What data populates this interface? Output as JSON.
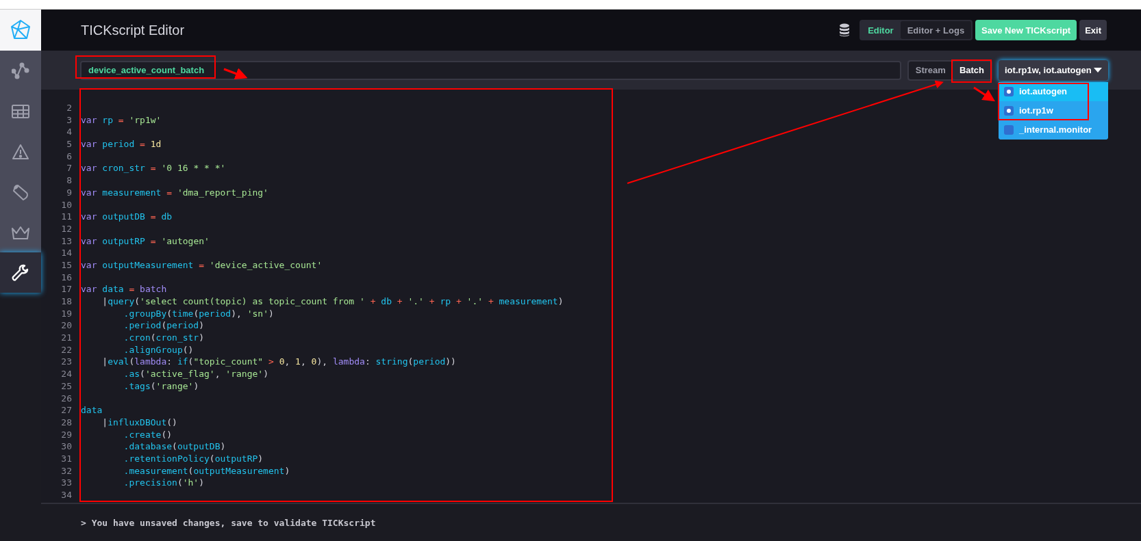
{
  "sidebar": {
    "items": [
      {
        "selected": false
      },
      {
        "selected": false
      },
      {
        "selected": false
      },
      {
        "selected": false
      },
      {
        "selected": false
      },
      {
        "selected": true
      }
    ]
  },
  "header": {
    "title": "TICKscript Editor",
    "view_tabs": [
      {
        "label": "Editor",
        "selected": true
      },
      {
        "label": "Editor + Logs",
        "selected": false
      }
    ],
    "save_button": "Save New TICKscript",
    "exit_button": "Exit"
  },
  "toolbar": {
    "script_name": "device_active_count_batch",
    "type_tabs": [
      {
        "label": "Stream",
        "selected": false
      },
      {
        "label": "Batch",
        "selected": true
      }
    ],
    "db_dropdown": {
      "value": "iot.rp1w, iot.autogen",
      "expanded": true,
      "options": [
        {
          "label": "iot.autogen",
          "selected": true,
          "hovered": true
        },
        {
          "label": "iot.rp1w",
          "selected": true,
          "hovered": false
        },
        {
          "label": "_internal.monitor",
          "selected": false,
          "hovered": false
        }
      ]
    }
  },
  "code": {
    "lines": [
      {
        "number": "2"
      },
      {
        "number": "3",
        "tokens": [
          {
            "kind": "keyword",
            "text": "var"
          },
          {
            "kind": "ident",
            "text": " rp"
          },
          {
            "kind": "operator",
            "text": " = "
          },
          {
            "kind": "string",
            "text": "'rp1w'"
          }
        ]
      },
      {
        "number": "4"
      },
      {
        "number": "5",
        "tokens": [
          {
            "kind": "keyword",
            "text": "var"
          },
          {
            "kind": "ident",
            "text": " period"
          },
          {
            "kind": "operator",
            "text": " = "
          },
          {
            "kind": "number",
            "text": "1d"
          }
        ]
      },
      {
        "number": "6"
      },
      {
        "number": "7",
        "tokens": [
          {
            "kind": "keyword",
            "text": "var"
          },
          {
            "kind": "ident",
            "text": " cron_str"
          },
          {
            "kind": "operator",
            "text": " = "
          },
          {
            "kind": "string",
            "text": "'0 16 * * *'"
          }
        ]
      },
      {
        "number": "8"
      },
      {
        "number": "9",
        "tokens": [
          {
            "kind": "keyword",
            "text": "var"
          },
          {
            "kind": "ident",
            "text": " measurement"
          },
          {
            "kind": "operator",
            "text": " = "
          },
          {
            "kind": "string",
            "text": "'dma_report_ping'"
          }
        ]
      },
      {
        "number": "10"
      },
      {
        "number": "11",
        "tokens": [
          {
            "kind": "keyword",
            "text": "var"
          },
          {
            "kind": "ident",
            "text": " outputDB"
          },
          {
            "kind": "operator",
            "text": " = "
          },
          {
            "kind": "ident",
            "text": "db"
          }
        ]
      },
      {
        "number": "12"
      },
      {
        "number": "13",
        "tokens": [
          {
            "kind": "keyword",
            "text": "var"
          },
          {
            "kind": "ident",
            "text": " outputRP"
          },
          {
            "kind": "operator",
            "text": " = "
          },
          {
            "kind": "string",
            "text": "'autogen'"
          }
        ]
      },
      {
        "number": "14"
      },
      {
        "number": "15",
        "tokens": [
          {
            "kind": "keyword",
            "text": "var"
          },
          {
            "kind": "ident",
            "text": " outputMeasurement"
          },
          {
            "kind": "operator",
            "text": " = "
          },
          {
            "kind": "string",
            "text": "'device_active_count'"
          }
        ]
      },
      {
        "number": "16"
      },
      {
        "number": "17",
        "tokens": [
          {
            "kind": "keyword",
            "text": "var"
          },
          {
            "kind": "ident",
            "text": " data"
          },
          {
            "kind": "operator",
            "text": " = "
          },
          {
            "kind": "keyword",
            "text": "batch"
          }
        ]
      },
      {
        "number": "18",
        "tokens": [
          {
            "kind": "plain",
            "text": "    |"
          },
          {
            "kind": "ident",
            "text": "query"
          },
          {
            "kind": "plain",
            "text": "("
          },
          {
            "kind": "string",
            "text": "'select count(topic) as topic_count from '"
          },
          {
            "kind": "operator",
            "text": " + "
          },
          {
            "kind": "ident",
            "text": "db"
          },
          {
            "kind": "operator",
            "text": " + "
          },
          {
            "kind": "string",
            "text": "'.'"
          },
          {
            "kind": "operator",
            "text": " + "
          },
          {
            "kind": "ident",
            "text": "rp"
          },
          {
            "kind": "operator",
            "text": " + "
          },
          {
            "kind": "string",
            "text": "'.'"
          },
          {
            "kind": "operator",
            "text": " + "
          },
          {
            "kind": "ident",
            "text": "measurement"
          },
          {
            "kind": "plain",
            "text": ")"
          }
        ]
      },
      {
        "number": "19",
        "tokens": [
          {
            "kind": "ident",
            "text": "        .groupBy"
          },
          {
            "kind": "plain",
            "text": "("
          },
          {
            "kind": "ident",
            "text": "time"
          },
          {
            "kind": "plain",
            "text": "("
          },
          {
            "kind": "ident",
            "text": "period"
          },
          {
            "kind": "plain",
            "text": "), "
          },
          {
            "kind": "string",
            "text": "'sn'"
          },
          {
            "kind": "plain",
            "text": ")"
          }
        ]
      },
      {
        "number": "20",
        "tokens": [
          {
            "kind": "ident",
            "text": "        .period"
          },
          {
            "kind": "plain",
            "text": "("
          },
          {
            "kind": "ident",
            "text": "period"
          },
          {
            "kind": "plain",
            "text": ")"
          }
        ]
      },
      {
        "number": "21",
        "tokens": [
          {
            "kind": "ident",
            "text": "        .cron"
          },
          {
            "kind": "plain",
            "text": "("
          },
          {
            "kind": "ident",
            "text": "cron_str"
          },
          {
            "kind": "plain",
            "text": ")"
          }
        ]
      },
      {
        "number": "22",
        "tokens": [
          {
            "kind": "ident",
            "text": "        .alignGroup"
          },
          {
            "kind": "plain",
            "text": "()"
          }
        ]
      },
      {
        "number": "23",
        "tokens": [
          {
            "kind": "plain",
            "text": "    |"
          },
          {
            "kind": "ident",
            "text": "eval"
          },
          {
            "kind": "plain",
            "text": "("
          },
          {
            "kind": "keyword",
            "text": "lambda"
          },
          {
            "kind": "plain",
            "text": ": "
          },
          {
            "kind": "ident",
            "text": "if"
          },
          {
            "kind": "plain",
            "text": "("
          },
          {
            "kind": "string",
            "text": "\"topic_count\""
          },
          {
            "kind": "operator",
            "text": " > "
          },
          {
            "kind": "number",
            "text": "0"
          },
          {
            "kind": "plain",
            "text": ", "
          },
          {
            "kind": "number",
            "text": "1"
          },
          {
            "kind": "plain",
            "text": ", "
          },
          {
            "kind": "number",
            "text": "0"
          },
          {
            "kind": "plain",
            "text": "), "
          },
          {
            "kind": "keyword",
            "text": "lambda"
          },
          {
            "kind": "plain",
            "text": ": "
          },
          {
            "kind": "ident",
            "text": "string"
          },
          {
            "kind": "plain",
            "text": "("
          },
          {
            "kind": "ident",
            "text": "period"
          },
          {
            "kind": "plain",
            "text": "))"
          }
        ]
      },
      {
        "number": "24",
        "tokens": [
          {
            "kind": "ident",
            "text": "        .as"
          },
          {
            "kind": "plain",
            "text": "("
          },
          {
            "kind": "string",
            "text": "'active_flag'"
          },
          {
            "kind": "plain",
            "text": ", "
          },
          {
            "kind": "string",
            "text": "'range'"
          },
          {
            "kind": "plain",
            "text": ")"
          }
        ]
      },
      {
        "number": "25",
        "tokens": [
          {
            "kind": "ident",
            "text": "        .tags"
          },
          {
            "kind": "plain",
            "text": "("
          },
          {
            "kind": "string",
            "text": "'range'"
          },
          {
            "kind": "plain",
            "text": ")"
          }
        ]
      },
      {
        "number": "26"
      },
      {
        "number": "27",
        "tokens": [
          {
            "kind": "ident",
            "text": "data"
          }
        ]
      },
      {
        "number": "28",
        "tokens": [
          {
            "kind": "plain",
            "text": "    |"
          },
          {
            "kind": "ident",
            "text": "influxDBOut"
          },
          {
            "kind": "plain",
            "text": "()"
          }
        ]
      },
      {
        "number": "29",
        "tokens": [
          {
            "kind": "ident",
            "text": "        .create"
          },
          {
            "kind": "plain",
            "text": "()"
          }
        ]
      },
      {
        "number": "30",
        "tokens": [
          {
            "kind": "ident",
            "text": "        .database"
          },
          {
            "kind": "plain",
            "text": "("
          },
          {
            "kind": "ident",
            "text": "outputDB"
          },
          {
            "kind": "plain",
            "text": ")"
          }
        ]
      },
      {
        "number": "31",
        "tokens": [
          {
            "kind": "ident",
            "text": "        .retentionPolicy"
          },
          {
            "kind": "plain",
            "text": "("
          },
          {
            "kind": "ident",
            "text": "outputRP"
          },
          {
            "kind": "plain",
            "text": ")"
          }
        ]
      },
      {
        "number": "32",
        "tokens": [
          {
            "kind": "ident",
            "text": "        .measurement"
          },
          {
            "kind": "plain",
            "text": "("
          },
          {
            "kind": "ident",
            "text": "outputMeasurement"
          },
          {
            "kind": "plain",
            "text": ")"
          }
        ]
      },
      {
        "number": "33",
        "tokens": [
          {
            "kind": "ident",
            "text": "        .precision"
          },
          {
            "kind": "plain",
            "text": "("
          },
          {
            "kind": "string",
            "text": "'h'"
          },
          {
            "kind": "plain",
            "text": ")"
          }
        ]
      },
      {
        "number": "34"
      }
    ]
  },
  "status_bar": {
    "message": "> You have unsaved changes, save to validate TICKscript"
  }
}
